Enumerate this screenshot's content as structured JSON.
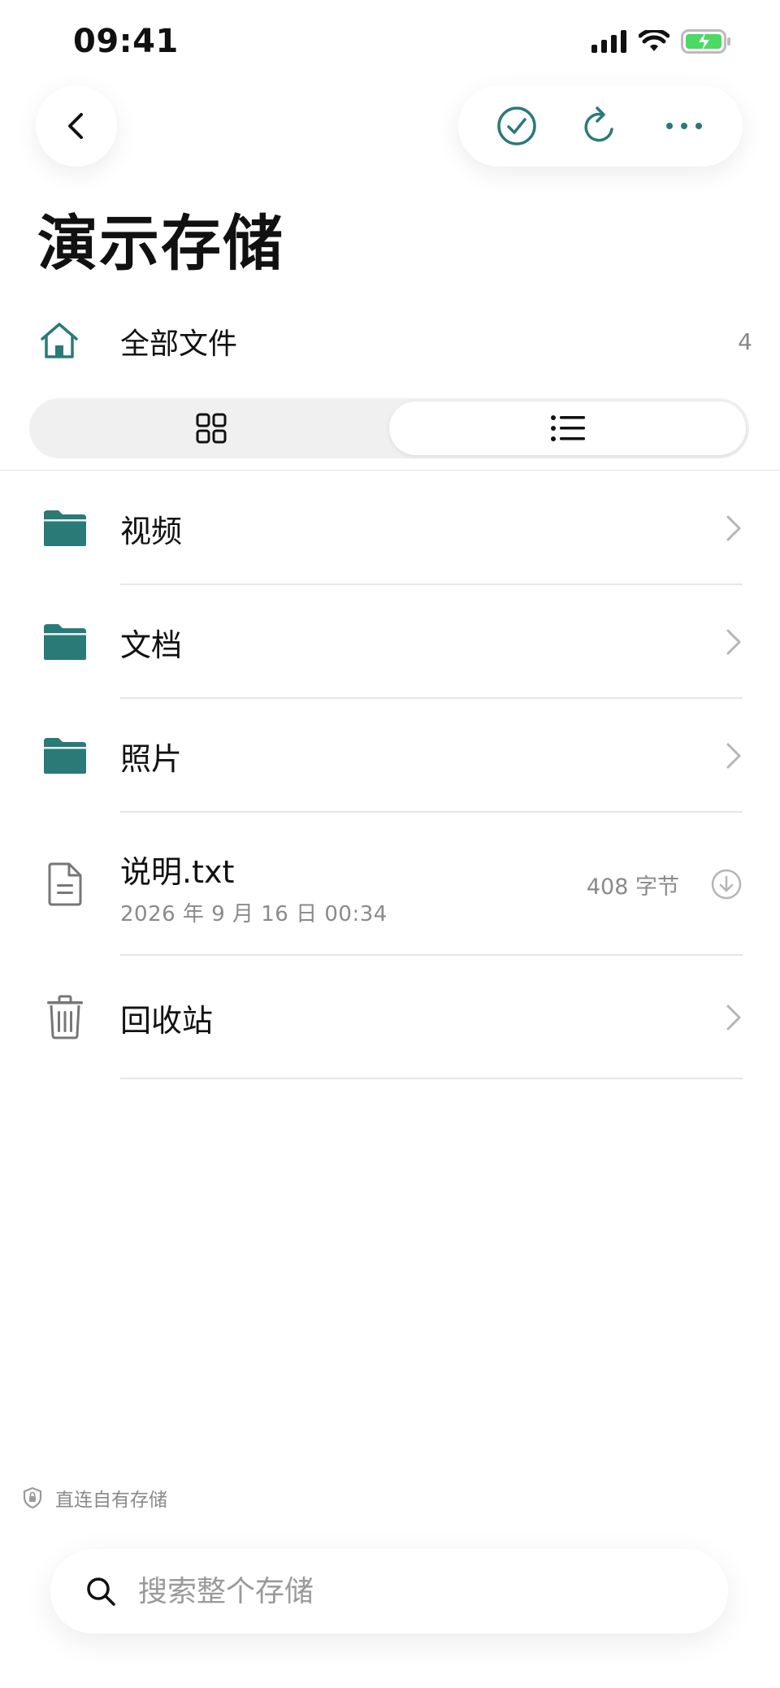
{
  "status_bar": {
    "time": "09:41"
  },
  "header": {
    "title": "演示存储"
  },
  "all_files": {
    "label": "全部文件",
    "count": "4"
  },
  "items": [
    {
      "name": "视频",
      "type": "folder"
    },
    {
      "name": "文档",
      "type": "folder"
    },
    {
      "name": "照片",
      "type": "folder"
    },
    {
      "name": "说明.txt",
      "type": "file",
      "date": "2026 年 9 月 16 日 00:34",
      "size": "408 字节"
    },
    {
      "name": "回收站",
      "type": "trash"
    }
  ],
  "footer_note": "直连自有存储",
  "search": {
    "placeholder": "搜索整个存储"
  },
  "colors": {
    "accent": "#2a7a78",
    "folder": "#2a7a78"
  },
  "view_mode": "list"
}
